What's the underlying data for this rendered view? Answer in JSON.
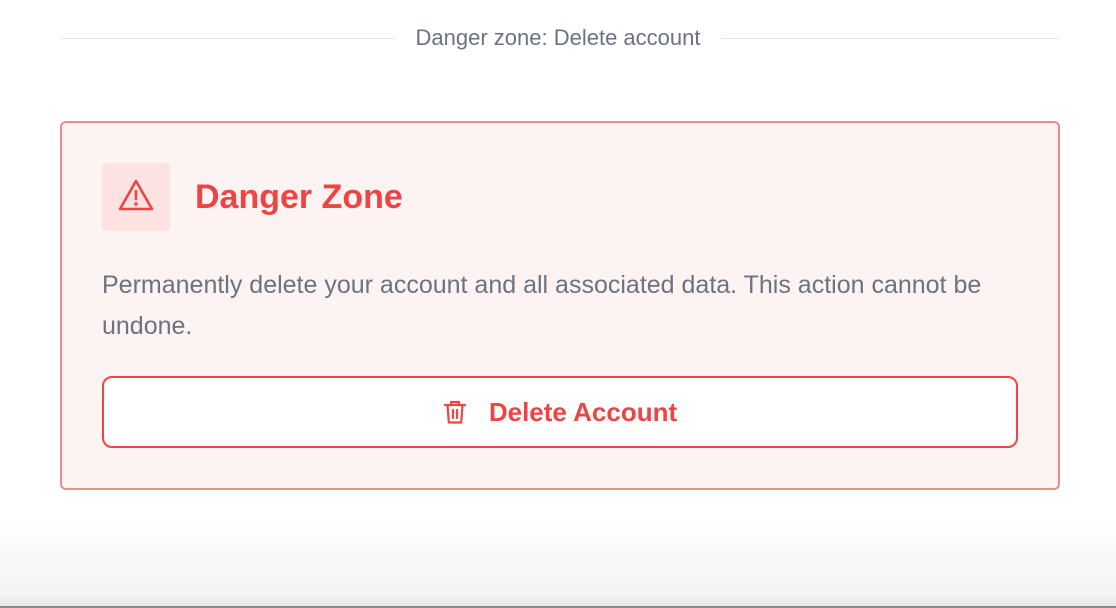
{
  "section_divider": {
    "label": "Danger zone: Delete account"
  },
  "danger_card": {
    "icon": "warning-triangle-icon",
    "title": "Danger Zone",
    "description": "Permanently delete your account and all associated data. This action cannot be undone.",
    "button": {
      "icon": "trash-icon",
      "label": "Delete Account"
    }
  },
  "colors": {
    "danger": "#ef4444",
    "card_background": "#fef3f3",
    "card_border": "#f08b8b",
    "icon_background": "#fde2e2",
    "muted_text": "#6b7280",
    "divider": "#e5e7eb"
  }
}
